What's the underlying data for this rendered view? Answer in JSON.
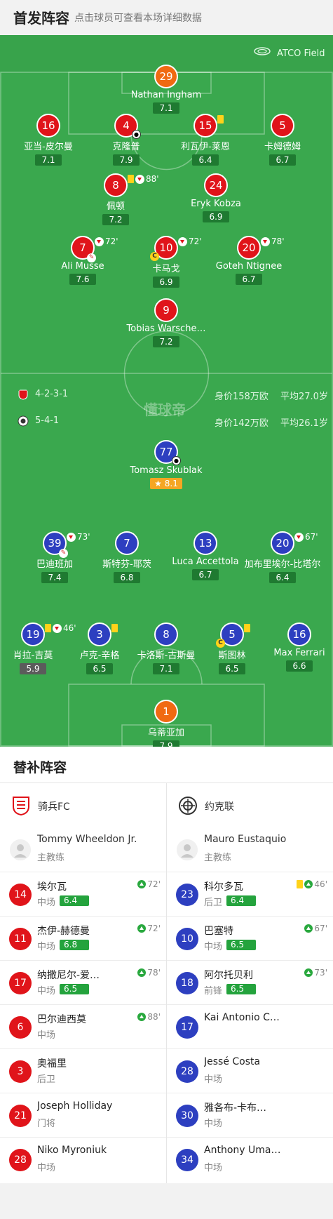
{
  "header": {
    "title": "首发阵容",
    "subtitle": "点击球员可查看本场详细数据"
  },
  "venue": {
    "name": "ATCO Field",
    "icon": "stadium-icon"
  },
  "home_team": {
    "formation": "4-2-3-1",
    "value": "身价158万欧",
    "avg_age": "平均27.0岁",
    "color": "#e0141a",
    "players": [
      {
        "num": "29",
        "name": "Nathan Ingham",
        "rating": "7.1",
        "color": "orange"
      },
      {
        "num": "16",
        "name": "亚当-皮尔曼",
        "rating": "7.1",
        "color": "red"
      },
      {
        "num": "4",
        "name": "克隆普",
        "rating": "7.9",
        "color": "red",
        "goal": true
      },
      {
        "num": "15",
        "name": "利瓦伊-莱恩",
        "rating": "6.4",
        "color": "red",
        "yellow": true
      },
      {
        "num": "5",
        "name": "卡姆德姆",
        "rating": "6.7",
        "color": "red"
      },
      {
        "num": "8",
        "name": "佩顿",
        "rating": "7.2",
        "color": "red",
        "yellow": true,
        "subout": true,
        "minute": "88'"
      },
      {
        "num": "24",
        "name": "Eryk Kobza",
        "rating": "6.9",
        "color": "red"
      },
      {
        "num": "7",
        "name": "Ali Musse",
        "rating": "7.6",
        "color": "red",
        "subout": true,
        "minute": "72'",
        "assist": true
      },
      {
        "num": "10",
        "name": "卡马戈",
        "rating": "6.9",
        "color": "red",
        "subout": true,
        "minute": "72'",
        "captain": true
      },
      {
        "num": "20",
        "name": "Goteh Ntignee",
        "rating": "6.7",
        "color": "red",
        "subout": true,
        "minute": "78'"
      },
      {
        "num": "9",
        "name": "Tobias Warsche…",
        "rating": "7.2",
        "color": "red"
      }
    ]
  },
  "away_team": {
    "formation": "5-4-1",
    "value": "身价142万欧",
    "avg_age": "平均26.1岁",
    "color": "#2d3fc0",
    "players": [
      {
        "num": "77",
        "name": "Tomasz Skublak",
        "rating": "8.1",
        "color": "blue",
        "goal": true,
        "star": true
      },
      {
        "num": "39",
        "name": "巴迪班加",
        "rating": "7.4",
        "color": "blue",
        "subout": true,
        "minute": "73'",
        "assist": true
      },
      {
        "num": "7",
        "name": "斯特芬-耶茨",
        "rating": "6.8",
        "color": "blue"
      },
      {
        "num": "13",
        "name": "Luca Accettola",
        "rating": "6.7",
        "color": "blue"
      },
      {
        "num": "20",
        "name": "加布里埃尔-比塔尔",
        "rating": "6.4",
        "color": "blue",
        "subout": true,
        "minute": "67'"
      },
      {
        "num": "19",
        "name": "肖拉-吉莫",
        "rating": "5.9",
        "color": "blue",
        "yellow": true,
        "subout": true,
        "minute": "46'",
        "low": true
      },
      {
        "num": "3",
        "name": "卢克-辛格",
        "rating": "6.5",
        "color": "blue",
        "yellow": true
      },
      {
        "num": "8",
        "name": "卡洛斯-古斯曼",
        "rating": "7.1",
        "color": "blue"
      },
      {
        "num": "5",
        "name": "斯图林",
        "rating": "6.5",
        "color": "blue",
        "yellow": true,
        "captain": true
      },
      {
        "num": "16",
        "name": "Max Ferrari",
        "rating": "6.6",
        "color": "blue"
      },
      {
        "num": "1",
        "name": "乌蒂亚加",
        "rating": "7.9",
        "color": "orange"
      }
    ]
  },
  "watermark": "懂球帝",
  "subs": {
    "title": "替补阵容",
    "home": {
      "team": "骑兵FC",
      "coach": {
        "name": "Tommy Wheeldon Jr.",
        "role": "主教练"
      },
      "players": [
        {
          "num": "14",
          "name": "埃尔瓦",
          "pos": "中场",
          "rating": "6.4",
          "minute": "72'"
        },
        {
          "num": "11",
          "name": "杰伊-赫德曼",
          "pos": "中场",
          "rating": "6.8",
          "minute": "72'"
        },
        {
          "num": "17",
          "name": "纳撒尼尔-爱…",
          "pos": "中场",
          "rating": "6.5",
          "minute": "78'"
        },
        {
          "num": "6",
          "name": "巴尔迪西莫",
          "pos": "中场",
          "rating": "",
          "minute": "88'"
        },
        {
          "num": "3",
          "name": "奥福里",
          "pos": "后卫",
          "rating": "",
          "minute": ""
        },
        {
          "num": "21",
          "name": "Joseph Holliday",
          "pos": "门将",
          "rating": "",
          "minute": ""
        },
        {
          "num": "28",
          "name": "Niko Myroniuk",
          "pos": "中场",
          "rating": "",
          "minute": ""
        }
      ]
    },
    "away": {
      "team": "约克联",
      "coach": {
        "name": "Mauro Eustaquio",
        "role": "主教练"
      },
      "players": [
        {
          "num": "23",
          "name": "科尔多瓦",
          "pos": "后卫",
          "rating": "6.4",
          "minute": "46'",
          "yellow": true
        },
        {
          "num": "10",
          "name": "巴塞特",
          "pos": "中场",
          "rating": "6.5",
          "minute": "67'"
        },
        {
          "num": "18",
          "name": "阿尔托贝利",
          "pos": "前锋",
          "rating": "6.5",
          "minute": "73'"
        },
        {
          "num": "17",
          "name": "Kai Antonio C…",
          "pos": "",
          "rating": "",
          "minute": ""
        },
        {
          "num": "28",
          "name": "Jessé Costa",
          "pos": "中场",
          "rating": "",
          "minute": ""
        },
        {
          "num": "30",
          "name": "雅各布-卡布…",
          "pos": "中场",
          "rating": "",
          "minute": ""
        },
        {
          "num": "34",
          "name": "Anthony Uma…",
          "pos": "中场",
          "rating": "",
          "minute": ""
        }
      ]
    }
  }
}
